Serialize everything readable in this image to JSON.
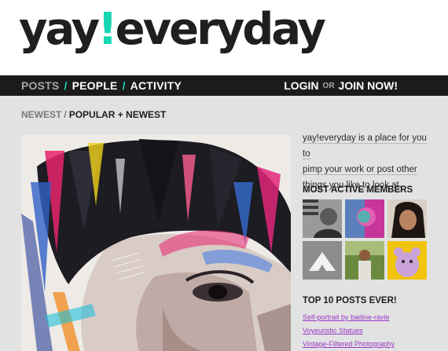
{
  "logo": {
    "part1": "yay",
    "bang": "!",
    "part2": "everyday"
  },
  "nav": {
    "posts": "POSTS",
    "people": "PEOPLE",
    "activity": "ACTIVITY",
    "sep": "/",
    "login": "LOGIN",
    "or": "OR",
    "join": "JOIN NOW!"
  },
  "subnav": {
    "newest": "NEWEST",
    "sep": "/",
    "popular": "POPULAR + NEWEST"
  },
  "sidebar": {
    "intro_lines": [
      "yay!everyday is a place for you to",
      "pimp your work or post other",
      "things you like to look at."
    ],
    "members_title": "MOST ACTIVE MEMBERS",
    "top_title": "TOP 10 POSTS EVER!",
    "top_posts": [
      "Self-portrait by badine-ravie",
      "Voyeuristic Statues",
      "Vintage-Filtered Photography"
    ]
  },
  "colors": {
    "accent": "#18d6b4",
    "link": "#9a36c8",
    "navbar": "#1b1b1b",
    "background": "#e2e2e2"
  }
}
